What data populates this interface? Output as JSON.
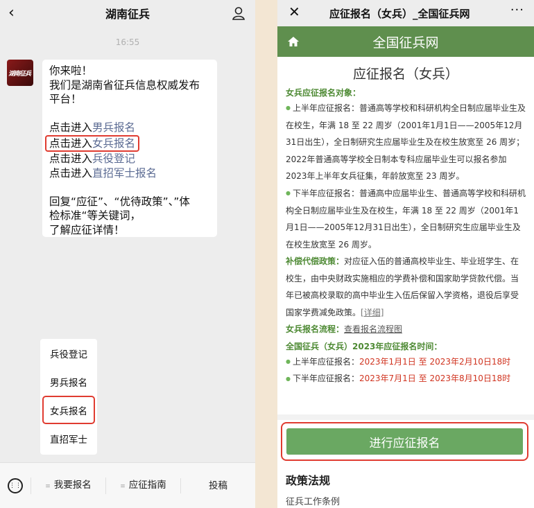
{
  "left": {
    "header": {
      "title": "湖南征兵"
    },
    "time": "16:55",
    "avatar_text": "湖南征兵",
    "message": {
      "l1": "你来啦！",
      "l2": "我们是湖南省征兵信息权威发布",
      "l3": "平台！",
      "prefix": "点击进入",
      "link_male": "男兵报名",
      "link_female": "女兵报名",
      "link_register": "兵役登记",
      "link_direct": "直招军士报名",
      "r1": "回复“应征”、“优待政策”、”体",
      "r2": "检标准“等关键词，",
      "r3": "了解应征详情！"
    },
    "menu": [
      "兵役登记",
      "男兵报名",
      "女兵报名",
      "直招军士"
    ],
    "bottom_tabs": [
      "我要报名",
      "应征指南",
      "投稿"
    ]
  },
  "right": {
    "top_title": "应征报名（女兵）_全国征兵网",
    "more": "···",
    "band_title": "全国征兵网",
    "h1": "应征报名（女兵）",
    "sec_target": "女兵应征报名对象：",
    "p1": "上半年应征报名：普通高等学校和科研机构全日制应届毕业生及在校生，年满 18 至 22 周岁（2001年1月1日——2005年12月31日出生），全日制研究生应届毕业生及在校生放宽至 26 周岁；2022年普通高等学校全日制本专科应届毕业生可以报名参加2023年上半年女兵征集，年龄放宽至 23 周岁。",
    "p2": "下半年应征报名：普通高中应届毕业生、普通高等学校和科研机构全日制应届毕业生及在校生，年满 18 至 22 周岁（2001年1月1日——2005年12月31日出生），全日制研究生应届毕业生及在校生放宽至 26 周岁。",
    "comp_label": "补偿代偿政策：",
    "comp_text": "对应征入伍的普通高校毕业生、毕业班学生、在校生，由中央财政实施相应的学费补偿和国家助学贷款代偿。当年已被高校录取的高中毕业生入伍后保留入学资格，退役后享受国家学费减免政策。",
    "detail_link": "[详细]",
    "flow_label": "女兵报名流程：",
    "flow_link": "查看报名流程图",
    "time_title": "全国征兵（女兵）2023年应征报名时间：",
    "h_first_label": "上半年应征报名：",
    "h_first_value": "2023年1月1日 至 2023年2月10日18时",
    "h_second_label": "下半年应征报名：",
    "h_second_value": "2023年7月1日 至 2023年8月10日18时",
    "button": "进行应征报名",
    "policy_title": "政策法规",
    "policy_item": "征兵工作条例"
  },
  "colors": {
    "accent_green": "#5f8f4e",
    "highlight_red": "#e03b30",
    "link_blue": "#5b6b93"
  }
}
